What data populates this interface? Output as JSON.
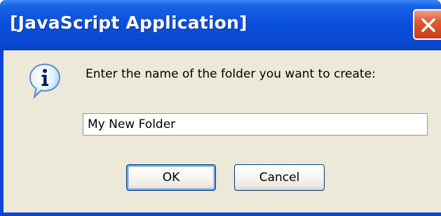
{
  "window": {
    "title": "[JavaScript Application]"
  },
  "dialog": {
    "icon": "info-icon",
    "prompt": "Enter the name of the folder you want to create:",
    "input_value": "My New Folder",
    "ok_label": "OK",
    "cancel_label": "Cancel"
  },
  "colors": {
    "titlebar": "#0a4bd6",
    "client_bg": "#ece9d8",
    "close_button": "#d44a22",
    "input_border": "#7f9db9",
    "button_border": "#003c74"
  }
}
